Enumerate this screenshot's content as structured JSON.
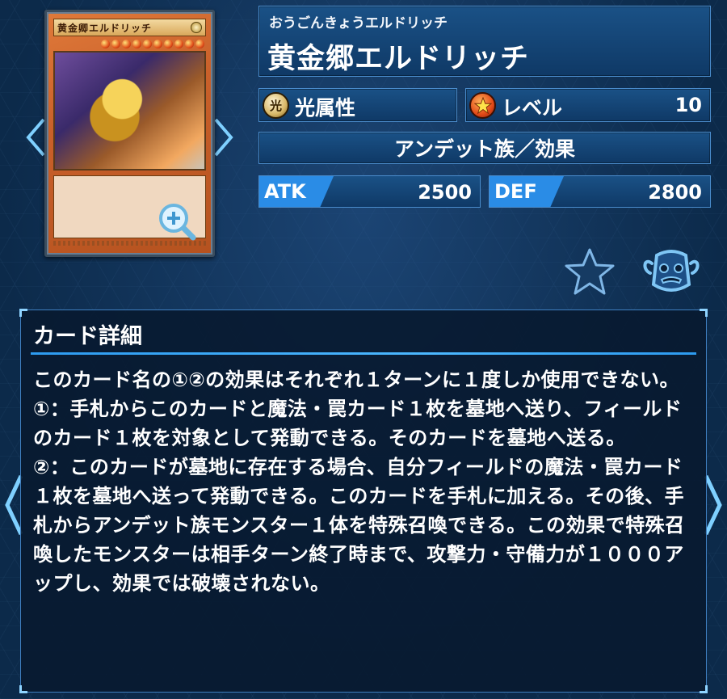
{
  "card": {
    "name_reading": "おうごんきょうエルドリッチ",
    "name": "黄金郷エルドリッチ",
    "mini_name": "黄金卿エルドリッチ",
    "attribute_icon": "attribute-light-icon",
    "attribute_glyph": "光",
    "attribute": "光属性",
    "level_icon": "level-star-icon",
    "level_label": "レベル",
    "level": "10",
    "type": "アンデット族／効果",
    "atk_label": "ATK",
    "atk": "2500",
    "def_label": "DEF",
    "def": "2800"
  },
  "icons": {
    "prev_card": "chevron-left-icon",
    "next_card": "chevron-right-icon",
    "zoom": "zoom-in-icon",
    "favorite": "star-icon",
    "deck": "deck-pot-icon",
    "prev_page": "chevron-left-icon",
    "next_page": "chevron-right-icon"
  },
  "details": {
    "heading": "カード詳細",
    "text": "このカード名の①②の効果はそれぞれ１ターンに１度しか使用できない。\n①：手札からこのカードと魔法・罠カード１枚を墓地へ送り、フィールドのカード１枚を対象として発動できる。そのカードを墓地へ送る。\n②：このカードが墓地に存在する場合、自分フィールドの魔法・罠カード１枚を墓地へ送って発動できる。このカードを手札に加える。その後、手札からアンデット族モンスター１体を特殊召喚できる。この効果で特殊召喚したモンスターは相手ターン終了時まで、攻撃力・守備力が１０００アップし、効果では破壊されない。"
  },
  "colors": {
    "background": "#0c2a4a",
    "panel": "#134677",
    "accent": "#2a8ce6",
    "arrow": "#7fd0ff"
  }
}
